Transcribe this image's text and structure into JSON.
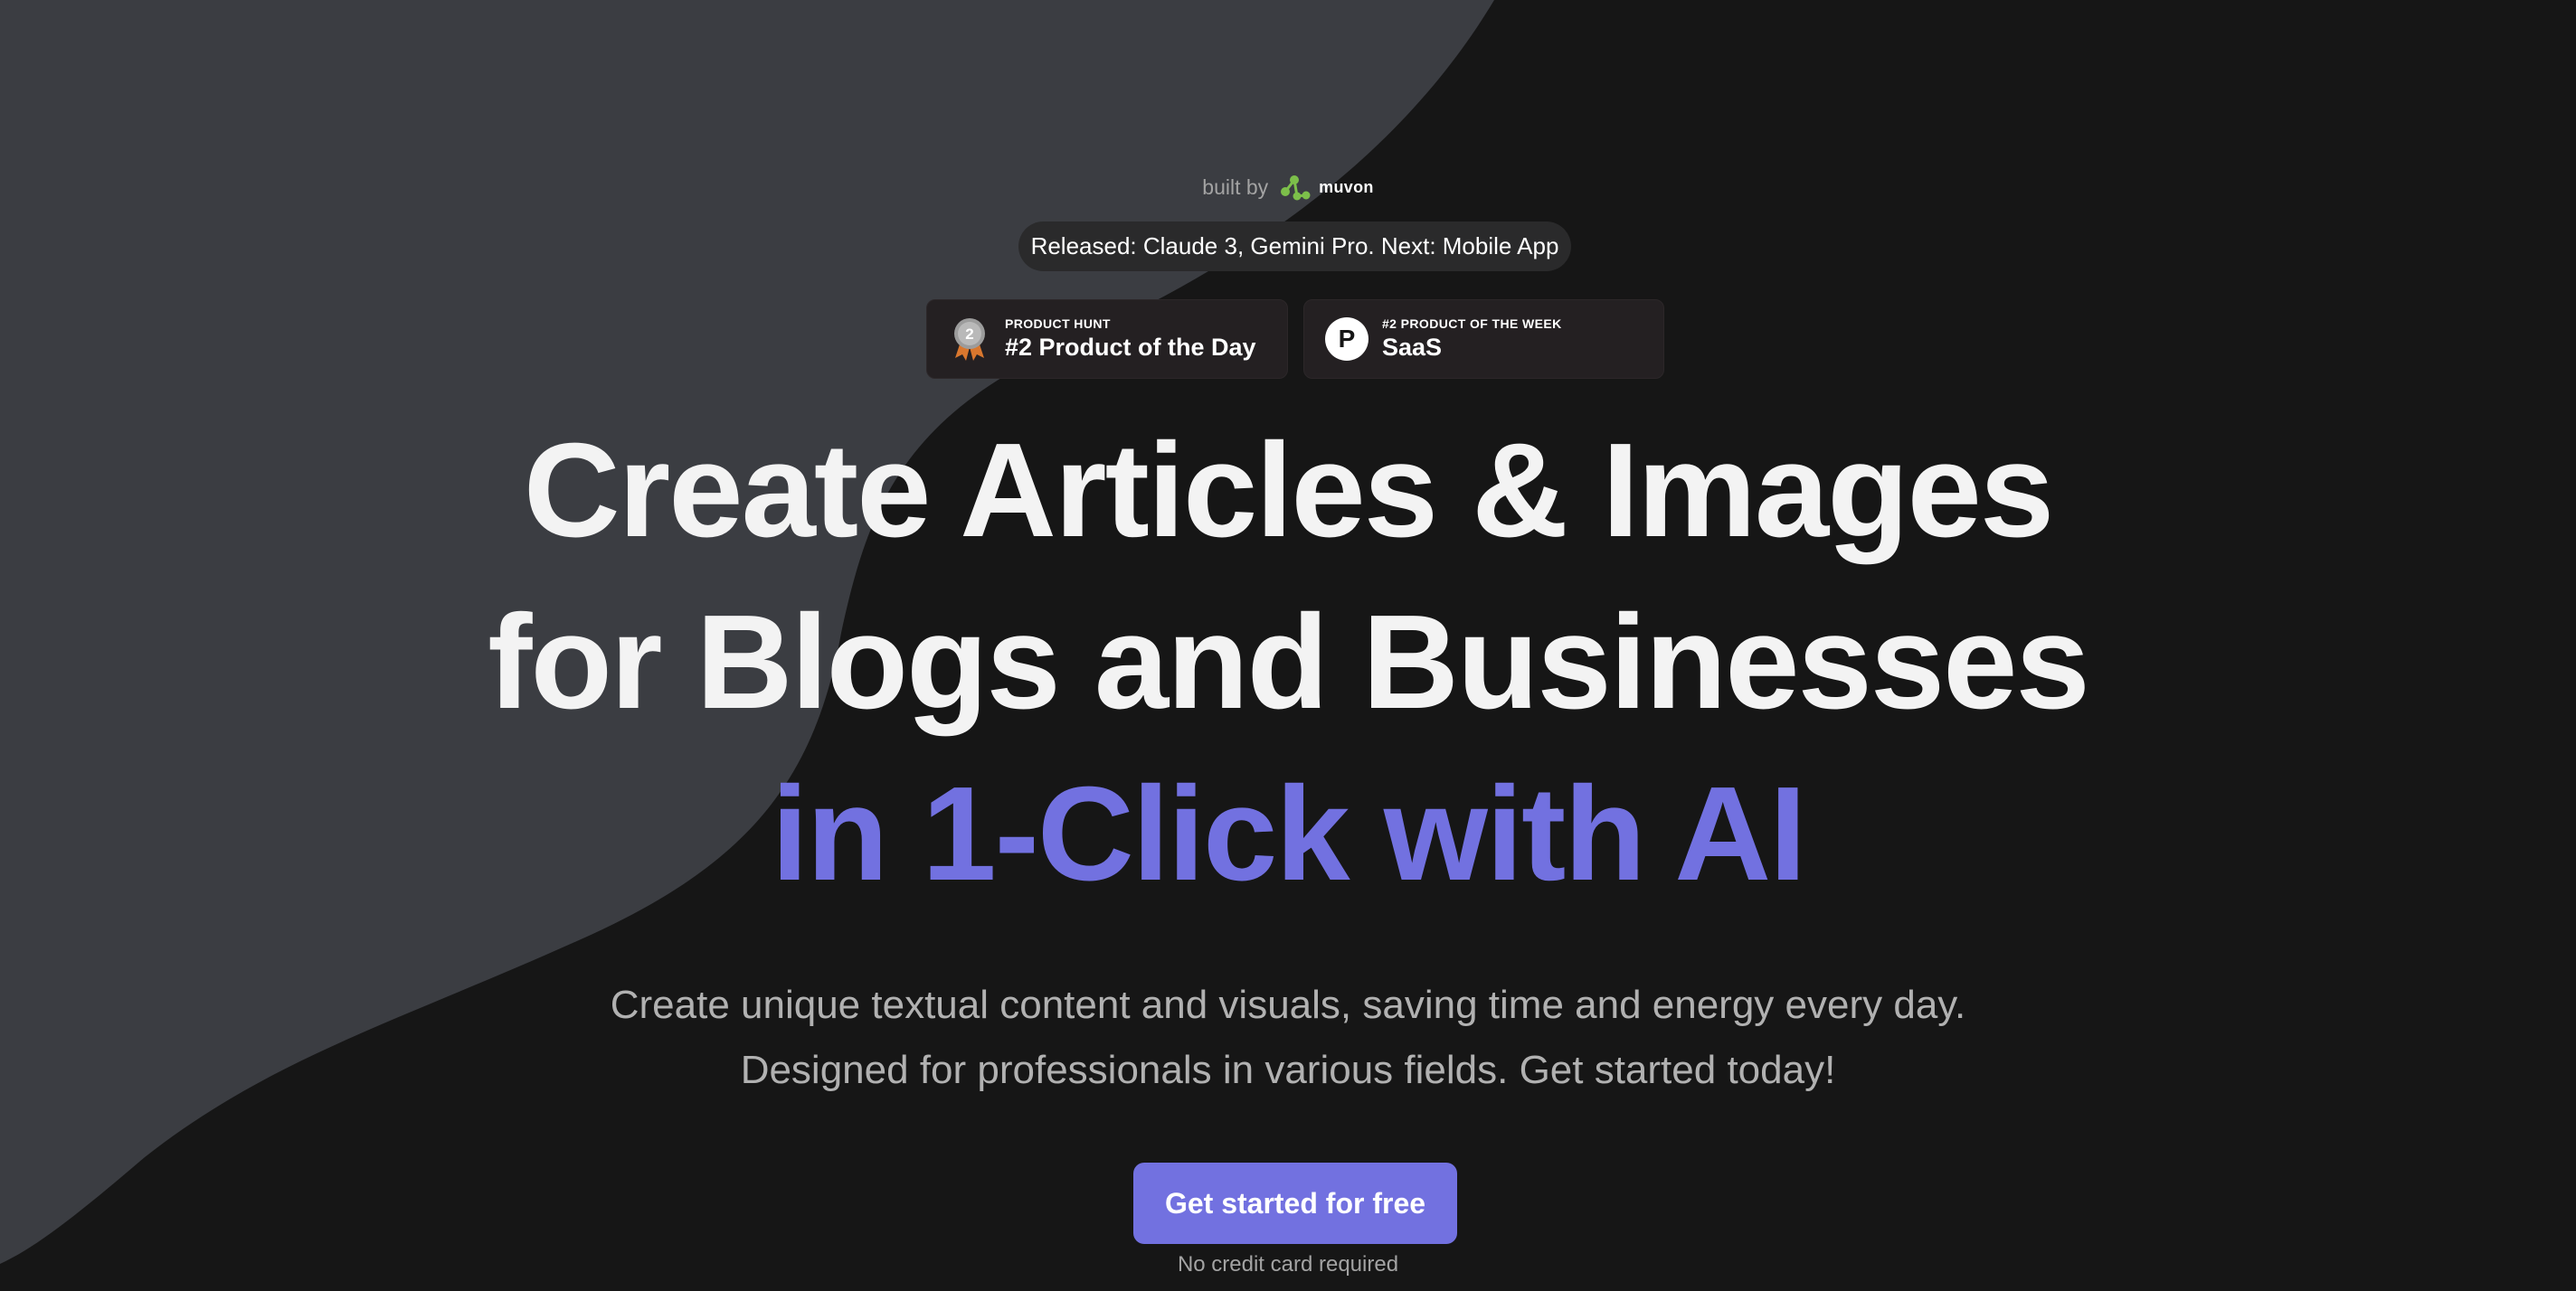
{
  "built_by": {
    "prefix": "built by",
    "brand": "muvon"
  },
  "release": {
    "text": "Released: Claude 3, Gemini Pro. Next: Mobile App"
  },
  "badges": [
    {
      "kicker": "PRODUCT HUNT",
      "title": "#2 Product of the Day",
      "icon": "medal-icon",
      "medal_number": "2"
    },
    {
      "kicker": "#2 PRODUCT OF THE WEEK",
      "title": "SaaS",
      "icon": "producthunt-icon",
      "icon_letter": "P"
    }
  ],
  "headline": {
    "line1": "Create Articles & Images",
    "line2": "for Blogs and Businesses",
    "line3": "in 1-Click with AI"
  },
  "subtext": {
    "line1": "Create unique textual content and visuals, saving time and energy every day.",
    "line2": "Designed for professionals in various fields. Get started today!"
  },
  "cta": {
    "label": "Get started for free",
    "note": "No credit card required"
  },
  "colors": {
    "background": "#161616",
    "blob": "#3b3d42",
    "accent": "#7271e0",
    "pill": "#2a2a2b",
    "badge": "#242022",
    "logo_green": "#7cbf4a"
  }
}
